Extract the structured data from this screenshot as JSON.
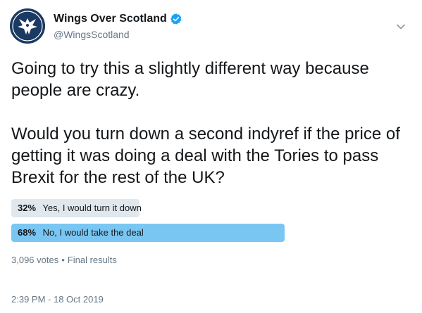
{
  "author": {
    "name": "Wings Over Scotland",
    "handle": "@WingsScotland",
    "avatar_icon": "wings-eagle-logo",
    "verified": true
  },
  "tweet": {
    "text": "Going to try this a slightly different way because people are crazy.\n\nWould you turn down a second indyref if the price of getting it was doing a deal with the Tories to pass Brexit for the rest of the UK?"
  },
  "poll": {
    "options": [
      {
        "percent_label": "32%",
        "label": "Yes, I would turn it down",
        "fraction": 0.32,
        "winner": false
      },
      {
        "percent_label": "68%",
        "label": "No, I would take the deal",
        "fraction": 0.68,
        "winner": true
      }
    ],
    "votes": "3,096 votes",
    "separator": "•",
    "status": "Final results"
  },
  "timestamp": "2:39 PM - 18 Oct 2019",
  "colors": {
    "winner_bar": "#7ac6f3",
    "loser_bar": "#e1e8ed",
    "verified_badge": "#1da1f2",
    "secondary_text": "#657786"
  }
}
